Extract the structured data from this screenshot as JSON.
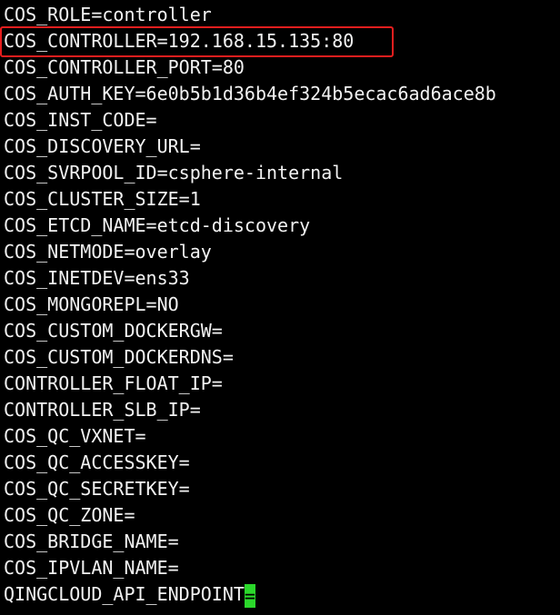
{
  "terminal": {
    "lines": [
      "COS_ROLE=controller",
      "COS_CONTROLLER=192.168.15.135:80",
      "COS_CONTROLLER_PORT=80",
      "COS_AUTH_KEY=6e0b5b1d36b4ef324b5ecac6ad6ace8b",
      "COS_INST_CODE=",
      "COS_DISCOVERY_URL=",
      "COS_SVRPOOL_ID=csphere-internal",
      "COS_CLUSTER_SIZE=1",
      "COS_ETCD_NAME=etcd-discovery",
      "COS_NETMODE=overlay",
      "COS_INETDEV=ens33",
      "COS_MONGOREPL=NO",
      "COS_CUSTOM_DOCKERGW=",
      "COS_CUSTOM_DOCKERDNS=",
      "CONTROLLER_FLOAT_IP=",
      "CONTROLLER_SLB_IP=",
      "COS_QC_VXNET=",
      "COS_QC_ACCESSKEY=",
      "COS_QC_SECRETKEY=",
      "COS_QC_ZONE=",
      "COS_BRIDGE_NAME=",
      "COS_IPVLAN_NAME=",
      "QINGCLOUD_API_ENDPOINT"
    ],
    "cursor_char": "=",
    "highlighted_line_index": 1,
    "colors": {
      "background": "#000000",
      "text": "#f2f2f2",
      "highlight_border": "#e81e1e",
      "cursor": "#2bd82b"
    }
  }
}
